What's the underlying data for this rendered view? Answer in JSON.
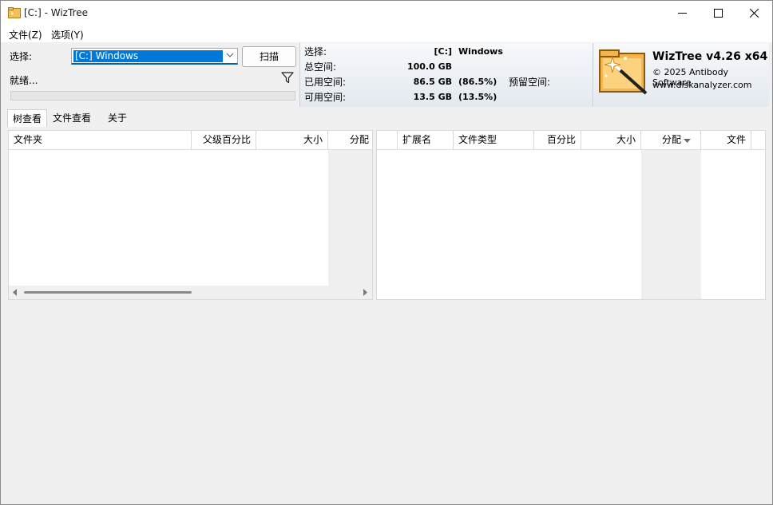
{
  "window": {
    "title": "[C:]  - WizTree",
    "controls": [
      "minimize",
      "maximize",
      "close"
    ]
  },
  "menu": {
    "file": "文件(Z)",
    "options": "选项(Y)"
  },
  "scan_panel": {
    "select_label": "选择:",
    "drive_value": "[C:] Windows",
    "scan_button": "扫描",
    "status": "就绪..."
  },
  "drive_info": {
    "select_label": "选择:",
    "drive_letter": "[C:]",
    "drive_name": "Windows",
    "total_label": "总空间:",
    "total_value": "100.0 GB",
    "used_label": "已用空间:",
    "used_value": "86.5 GB",
    "used_pct": "(86.5%)",
    "reserved_label": "预留空间:",
    "free_label": "可用空间:",
    "free_value": "13.5 GB",
    "free_pct": "(13.5%)"
  },
  "branding": {
    "title": "WizTree v4.26 x64",
    "copyright": "© 2025 Antibody Software",
    "website": "www.diskanalyzer.com"
  },
  "tabs": [
    "树查看",
    "文件查看",
    "关于"
  ],
  "tree_table": {
    "columns": [
      "文件夹",
      "父级百分比",
      "大小",
      "分配"
    ]
  },
  "ext_table": {
    "columns": [
      "扩展名",
      "文件类型",
      "百分比",
      "大小",
      "分配",
      "文件"
    ]
  },
  "colors": {
    "accent": "#0078d7",
    "panel_gradient_top": "#f7f9fb",
    "panel_gradient_bottom": "#e3e9ef"
  }
}
